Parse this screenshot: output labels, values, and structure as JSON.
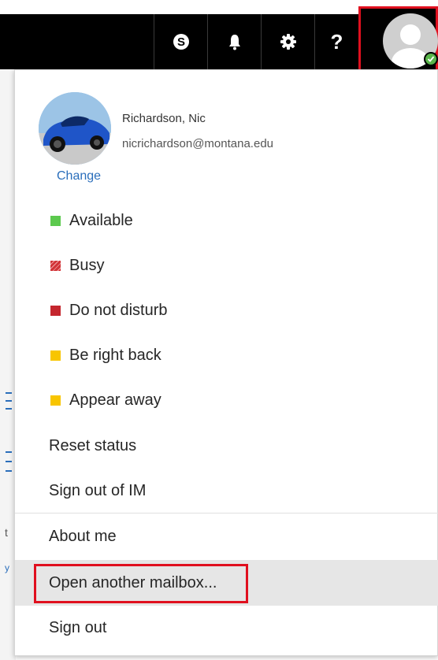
{
  "topbar": {
    "icons": [
      "skype-icon",
      "bell-icon",
      "gear-icon",
      "help-icon",
      "avatar-icon"
    ],
    "help_glyph": "?"
  },
  "colors": {
    "navbar": "#000000",
    "highlight": "#e0101f",
    "available": "#5cc94e",
    "busy": "#d13438",
    "dnd": "#c4262e",
    "brb": "#f8c500",
    "away": "#f8c500",
    "link": "#2a6ebb"
  },
  "profile": {
    "name": "Richardson, Nic",
    "email": "nicrichardson@montana.edu",
    "change_label": "Change"
  },
  "status_menu": [
    {
      "label": "Available",
      "icon": "available-swatch"
    },
    {
      "label": "Busy",
      "icon": "busy-swatch"
    },
    {
      "label": "Do not disturb",
      "icon": "dnd-swatch"
    },
    {
      "label": "Be right back",
      "icon": "brb-swatch"
    },
    {
      "label": "Appear away",
      "icon": "away-swatch"
    }
  ],
  "actions": {
    "reset_status": "Reset status",
    "sign_out_im": "Sign out of IM",
    "about_me": "About me",
    "open_mailbox": "Open another mailbox...",
    "sign_out": "Sign out"
  },
  "background": {
    "glyph_t": "t",
    "glyph_y": "y"
  }
}
